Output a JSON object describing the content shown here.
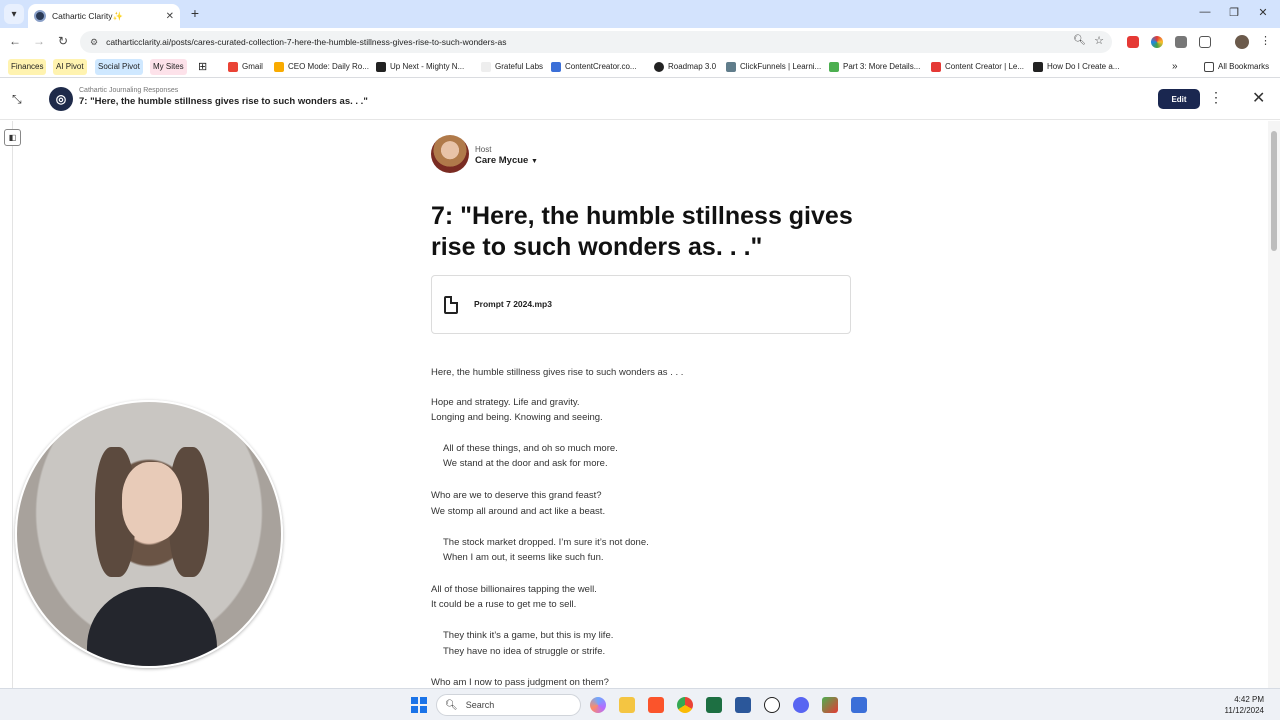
{
  "browser": {
    "tab_title": "Cathartic Clarity✨",
    "url": "catharticclarity.ai/posts/cares-curated-collection-7-here-the-humble-stillness-gives-rise-to-such-wonders-as",
    "bookmarks": [
      {
        "label": "Finances",
        "color": "#fff3b0"
      },
      {
        "label": "AI Pivot",
        "color": "#fff3b0"
      },
      {
        "label": "Social Pivot",
        "color": "#cfe8ff"
      },
      {
        "label": "My Sites",
        "color": "#fde2ea"
      },
      {
        "label": "Gmail",
        "icon": "gmail-icon"
      },
      {
        "label": "CEO Mode: Daily Ro...",
        "icon": "bookmark-icon"
      },
      {
        "label": "Up Next - Mighty N...",
        "icon": "bookmark-icon"
      },
      {
        "label": "Grateful Labs",
        "icon": "bookmark-icon"
      },
      {
        "label": "ContentCreator.co...",
        "icon": "bookmark-icon"
      },
      {
        "label": "Roadmap 3.0",
        "icon": "bookmark-icon"
      },
      {
        "label": "ClickFunnels | Learni...",
        "icon": "bookmark-icon"
      },
      {
        "label": "Part 3: More Details...",
        "icon": "bookmark-icon"
      },
      {
        "label": "Content Creator | Le...",
        "icon": "bookmark-icon"
      },
      {
        "label": "How Do I Create a...",
        "icon": "bookmark-icon"
      }
    ],
    "all_bookmarks": "All Bookmarks"
  },
  "header": {
    "breadcrumb": "Cathartic Journaling Responses",
    "title": "7: \"Here, the humble stillness gives rise to such wonders as. . .\"",
    "edit_label": "Edit"
  },
  "post": {
    "host_label": "Host",
    "host_name": "Care Mycue",
    "title": "7: \"Here, the humble stillness gives rise to such wonders as. . .\"",
    "attachment_name": "Prompt 7 2024.mp3",
    "lines": [
      "Here, the humble stillness gives rise to such wonders as . . .",
      "Hope and strategy. Life and gravity.",
      "Longing and being. Knowing and seeing.",
      "All of these things, and oh so much more.",
      "We stand at the door and ask for more.",
      "Who are we to deserve this grand feast?",
      "We stomp all around and act like a beast.",
      "The stock market dropped. I’m sure it’s not done.",
      "When I am out, it seems like such fun.",
      "All of those billionaires tapping the well.",
      "It could be a ruse to get me to sell.",
      "They think it’s a game, but this is my life.",
      "They have no idea of struggle or strife.",
      "Who am I now to pass judgment on them?"
    ]
  },
  "taskbar": {
    "search_placeholder": "Search",
    "time": "4:42 PM",
    "date": "11/12/2024"
  }
}
